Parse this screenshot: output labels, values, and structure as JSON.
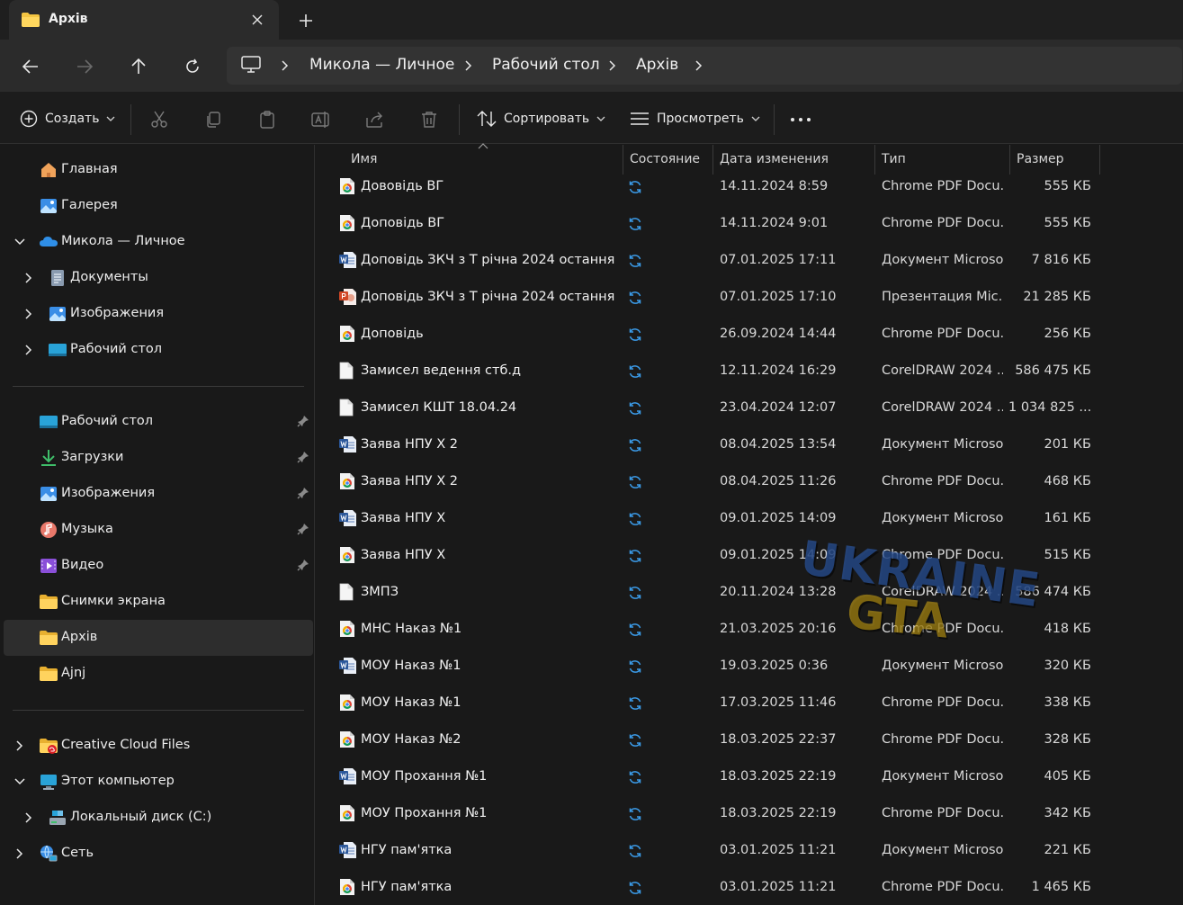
{
  "tab": {
    "title": "Архів"
  },
  "breadcrumb": [
    "Микола — Личное",
    "Рабочий стол",
    "Архів"
  ],
  "toolbar": {
    "create_label": "Создать",
    "sort_label": "Сортировать",
    "view_label": "Просмотреть"
  },
  "sidebar": {
    "top": [
      {
        "label": "Главная",
        "icon": "home-icon"
      },
      {
        "label": "Галерея",
        "icon": "gallery-icon"
      },
      {
        "label": "Микола — Личное",
        "icon": "onedrive-icon"
      },
      {
        "label": "Документы",
        "icon": "documents-icon"
      },
      {
        "label": "Изображения",
        "icon": "pictures-icon"
      },
      {
        "label": "Рабочий стол",
        "icon": "desktop-icon"
      }
    ],
    "quick": [
      {
        "label": "Рабочий стол",
        "icon": "desktop-icon",
        "pinned": true
      },
      {
        "label": "Загрузки",
        "icon": "downloads-icon",
        "pinned": true
      },
      {
        "label": "Изображения",
        "icon": "pictures-icon",
        "pinned": true
      },
      {
        "label": "Музыка",
        "icon": "music-icon",
        "pinned": true
      },
      {
        "label": "Видео",
        "icon": "video-icon",
        "pinned": true
      },
      {
        "label": "Снимки экрана",
        "icon": "folder-icon",
        "pinned": false
      },
      {
        "label": "Архів",
        "icon": "folder-icon",
        "pinned": false
      },
      {
        "label": "Ajnj",
        "icon": "folder-icon",
        "pinned": false
      }
    ],
    "bottom": [
      {
        "label": "Creative Cloud Files",
        "icon": "creative-cloud-icon"
      },
      {
        "label": "Этот компьютер",
        "icon": "computer-icon"
      },
      {
        "label": "Локальный диск (C:)",
        "icon": "drive-icon"
      },
      {
        "label": "Сеть",
        "icon": "network-icon"
      }
    ]
  },
  "columns": {
    "name": "Имя",
    "state": "Состояние",
    "date": "Дата изменения",
    "type": "Тип",
    "size": "Размер"
  },
  "files": [
    {
      "name": "Дововідь ВГ",
      "icon": "chrome-pdf-icon",
      "date": "14.11.2024 8:59",
      "type": "Chrome PDF Docu...",
      "size": "555 КБ"
    },
    {
      "name": "Доповідь ВГ",
      "icon": "chrome-pdf-icon",
      "date": "14.11.2024 9:01",
      "type": "Chrome PDF Docu...",
      "size": "555 КБ"
    },
    {
      "name": "Доповідь ЗКЧ з Т річна 2024 остання",
      "icon": "word-icon",
      "date": "07.01.2025 17:11",
      "type": "Документ Microso...",
      "size": "7 816 КБ"
    },
    {
      "name": "Доповідь ЗКЧ з Т річна 2024 остання",
      "icon": "powerpoint-icon",
      "date": "07.01.2025 17:10",
      "type": "Презентация Mic...",
      "size": "21 285 КБ"
    },
    {
      "name": "Доповідь",
      "icon": "chrome-pdf-icon",
      "date": "26.09.2024 14:44",
      "type": "Chrome PDF Docu...",
      "size": "256 КБ"
    },
    {
      "name": "Замисел ведення стб.д",
      "icon": "blank-file-icon",
      "date": "12.11.2024 16:29",
      "type": "CorelDRAW 2024 ...",
      "size": "586 475 КБ"
    },
    {
      "name": "Замисел КШТ 18.04.24",
      "icon": "blank-file-icon",
      "date": "23.04.2024 12:07",
      "type": "CorelDRAW 2024 ...",
      "size": "1 034 825 ..."
    },
    {
      "name": "Заява НПУ Х 2",
      "icon": "word-icon",
      "date": "08.04.2025 13:54",
      "type": "Документ Microso...",
      "size": "201 КБ"
    },
    {
      "name": "Заява НПУ Х 2",
      "icon": "chrome-pdf-icon",
      "date": "08.04.2025 11:26",
      "type": "Chrome PDF Docu...",
      "size": "468 КБ"
    },
    {
      "name": "Заява НПУ Х",
      "icon": "word-icon",
      "date": "09.01.2025 14:09",
      "type": "Документ Microso...",
      "size": "161 КБ"
    },
    {
      "name": "Заява НПУ Х",
      "icon": "chrome-pdf-icon",
      "date": "09.01.2025 14:09",
      "type": "Chrome PDF Docu...",
      "size": "515 КБ"
    },
    {
      "name": "ЗМПЗ",
      "icon": "blank-file-icon",
      "date": "20.11.2024 13:28",
      "type": "CorelDRAW 2024 ...",
      "size": "586 474 КБ"
    },
    {
      "name": "МНС Наказ №1",
      "icon": "chrome-pdf-icon",
      "date": "21.03.2025 20:16",
      "type": "Chrome PDF Docu...",
      "size": "418 КБ"
    },
    {
      "name": "МОУ Наказ №1",
      "icon": "word-icon",
      "date": "19.03.2025 0:36",
      "type": "Документ Microso...",
      "size": "320 КБ"
    },
    {
      "name": "МОУ Наказ №1",
      "icon": "chrome-pdf-icon",
      "date": "17.03.2025 11:46",
      "type": "Chrome PDF Docu...",
      "size": "338 КБ"
    },
    {
      "name": "МОУ Наказ №2",
      "icon": "chrome-pdf-icon",
      "date": "18.03.2025 22:37",
      "type": "Chrome PDF Docu...",
      "size": "328 КБ"
    },
    {
      "name": "МОУ Прохання №1",
      "icon": "word-icon",
      "date": "18.03.2025 22:19",
      "type": "Документ Microso...",
      "size": "405 КБ"
    },
    {
      "name": "МОУ Прохання №1",
      "icon": "chrome-pdf-icon",
      "date": "18.03.2025 22:19",
      "type": "Chrome PDF Docu...",
      "size": "342 КБ"
    },
    {
      "name": "НГУ пам'ятка",
      "icon": "word-icon",
      "date": "03.01.2025 11:21",
      "type": "Документ Microso...",
      "size": "221 КБ"
    },
    {
      "name": "НГУ пам'ятка",
      "icon": "chrome-pdf-icon",
      "date": "03.01.2025 11:21",
      "type": "Chrome PDF Docu...",
      "size": "1 465 КБ"
    }
  ],
  "watermark": {
    "line1": "UKRAINE",
    "line2": "GTA"
  }
}
